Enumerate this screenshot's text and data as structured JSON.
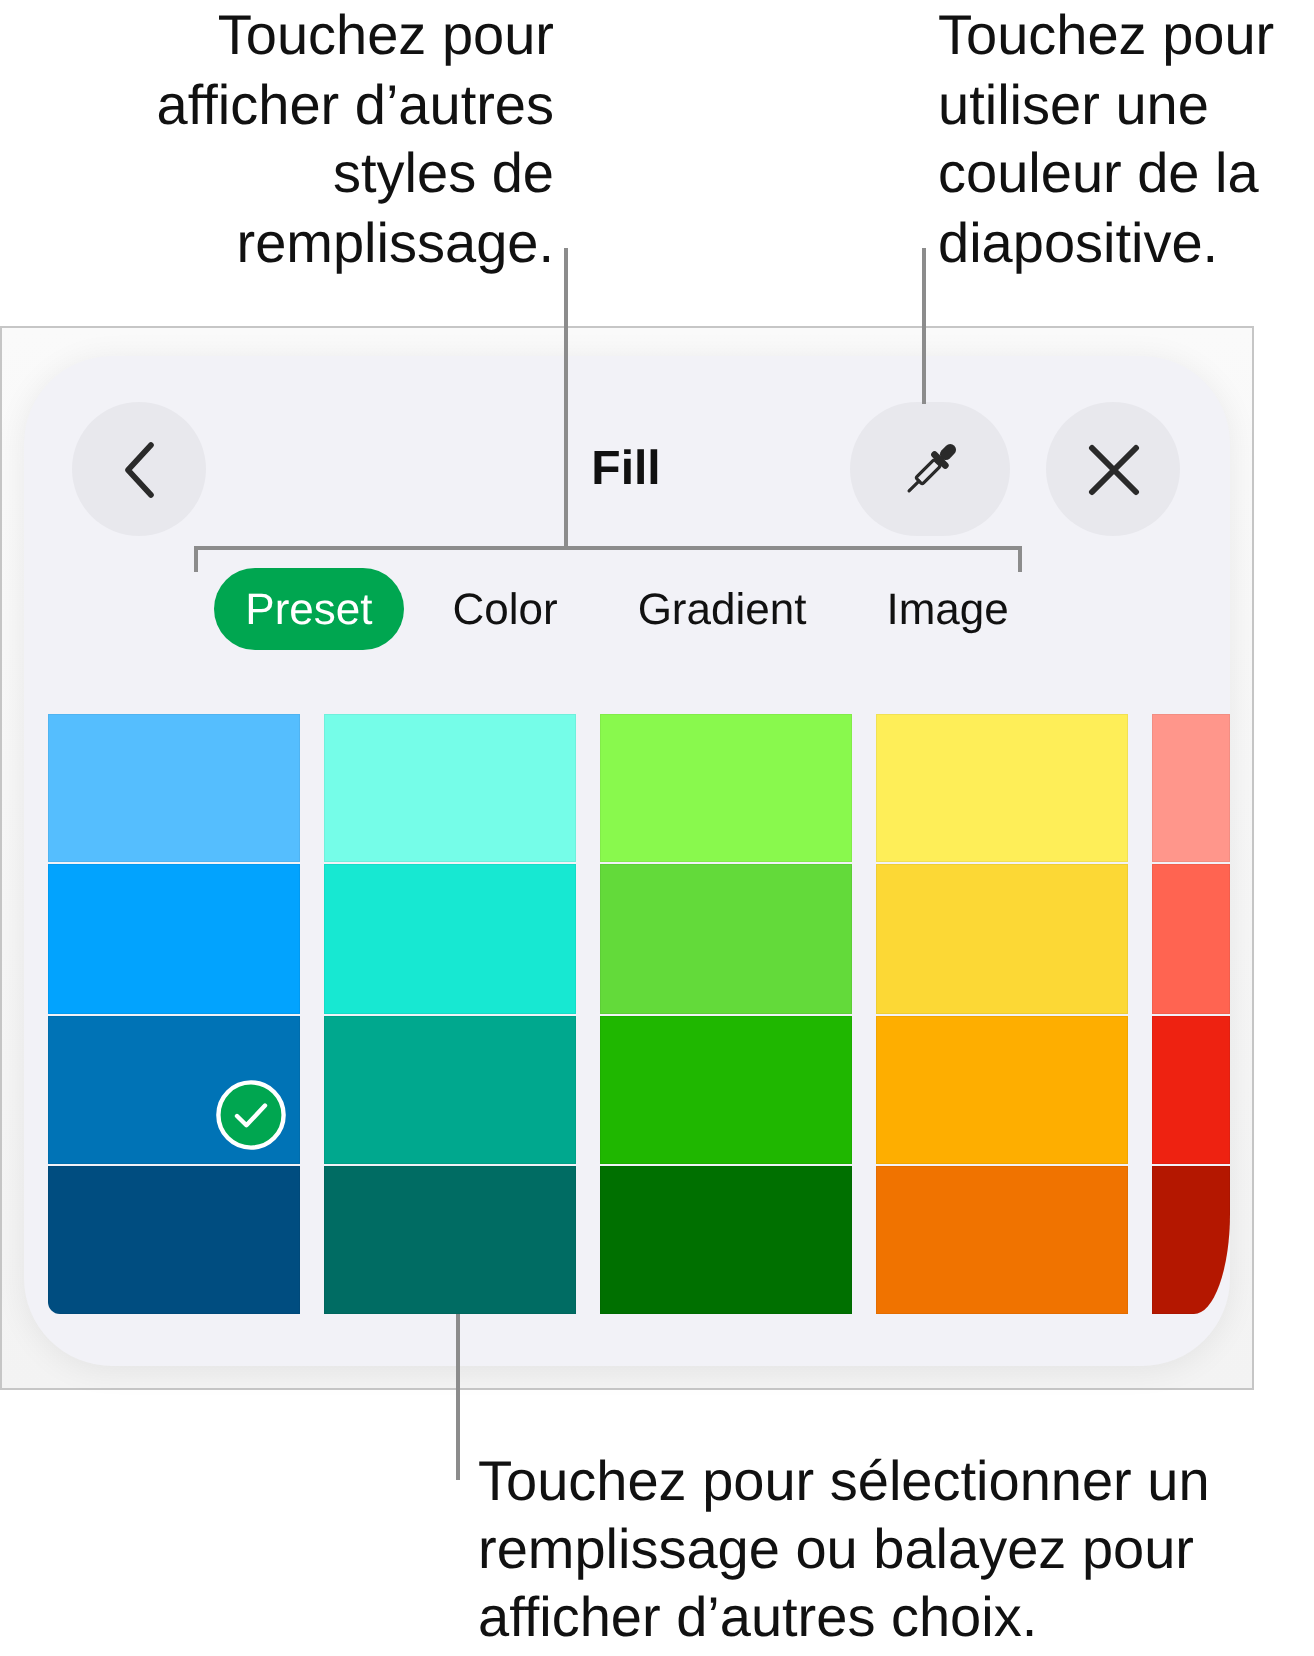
{
  "callouts": [
    {
      "text": "Touchez pour afficher d’autres styles de remplissage."
    },
    {
      "text": "Touchez pour utiliser une couleur de la diapositive."
    },
    {
      "text": "Touchez pour sélectionner un remplissage ou balayez pour afficher d’autres choix."
    }
  ],
  "panel": {
    "title": "Fill",
    "buttons": [
      {
        "kind": "back"
      },
      {
        "kind": "eyedropper"
      },
      {
        "kind": "close"
      }
    ],
    "tabs": [
      {
        "label": "Preset",
        "selected": true
      },
      {
        "label": "Color",
        "selected": false
      },
      {
        "label": "Gradient",
        "selected": false
      },
      {
        "label": "Image",
        "selected": false
      }
    ],
    "swatch_columns": [
      {
        "swatches": [
          {
            "color": "#55befe",
            "selected": false
          },
          {
            "color": "#02a3fe",
            "selected": false
          },
          {
            "color": "#0073b6",
            "selected": true
          },
          {
            "color": "#004d80",
            "selected": false
          }
        ]
      },
      {
        "swatches": [
          {
            "color": "#75fde8",
            "selected": false
          },
          {
            "color": "#17e8d2",
            "selected": false
          },
          {
            "color": "#00a88e",
            "selected": false
          },
          {
            "color": "#006c63",
            "selected": false
          }
        ]
      },
      {
        "swatches": [
          {
            "color": "#89f94d",
            "selected": false
          },
          {
            "color": "#63da3a",
            "selected": false
          },
          {
            "color": "#1fb700",
            "selected": false
          },
          {
            "color": "#007000",
            "selected": false
          }
        ]
      },
      {
        "swatches": [
          {
            "color": "#feee58",
            "selected": false
          },
          {
            "color": "#fcd835",
            "selected": false
          },
          {
            "color": "#feae00",
            "selected": false
          },
          {
            "color": "#f07300",
            "selected": false
          }
        ]
      },
      {
        "swatches": [
          {
            "color": "#ff968b",
            "selected": false
          },
          {
            "color": "#ff6451",
            "selected": false
          },
          {
            "color": "#ee2211",
            "selected": false
          },
          {
            "color": "#b41700",
            "selected": false
          }
        ]
      }
    ]
  }
}
